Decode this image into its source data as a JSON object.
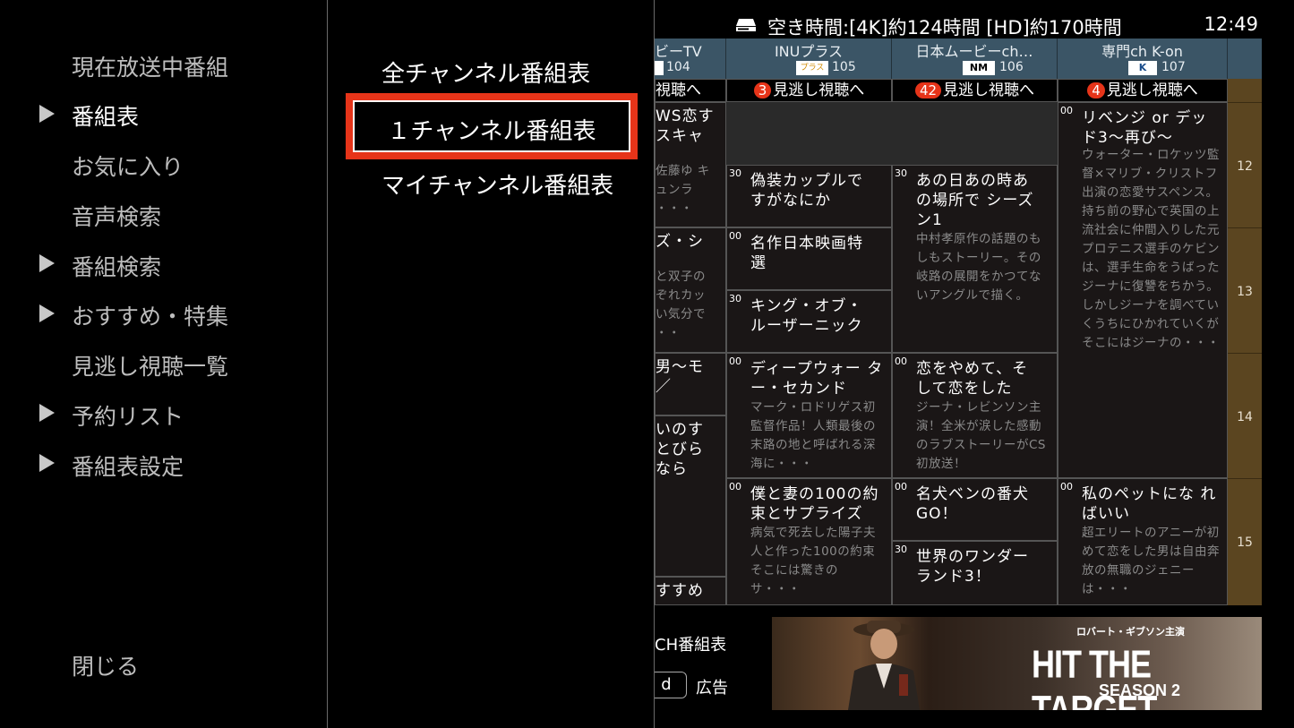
{
  "menu": {
    "items": [
      {
        "label": "現在放送中番組",
        "arrow": false,
        "active": false
      },
      {
        "label": "番組表",
        "arrow": true,
        "active": true
      },
      {
        "label": "お気に入り",
        "arrow": false,
        "active": false
      },
      {
        "label": "音声検索",
        "arrow": false,
        "active": false
      },
      {
        "label": "番組検索",
        "arrow": true,
        "active": false
      },
      {
        "label": "おすすめ・特集",
        "arrow": true,
        "active": false
      },
      {
        "label": "見逃し視聴一覧",
        "arrow": false,
        "active": false
      },
      {
        "label": "予約リスト",
        "arrow": true,
        "active": false
      },
      {
        "label": "番組表設定",
        "arrow": true,
        "active": false
      }
    ],
    "close_label": "閉じる"
  },
  "submenu": {
    "all_channels": "全チャンネル番組表",
    "one_channel": "１チャンネル番組表",
    "my_channel": "マイチャンネル番組表"
  },
  "guide": {
    "remaining_label": "空き時間:[4K]約124時間 [HD]約170時間",
    "clock": "12:49",
    "channels": [
      {
        "name": "ビーTV",
        "number": "104",
        "logo": "",
        "missed_count": "",
        "missed_label": "視聴へ"
      },
      {
        "name": "INUプラス",
        "number": "105",
        "logo": "プラス",
        "missed_count": "3",
        "missed_label": "見逃し視聴へ"
      },
      {
        "name": "日本ムービーch…",
        "number": "106",
        "logo": "NM",
        "missed_count": "42",
        "missed_label": "見逃し視聴へ"
      },
      {
        "name": "専門ch K-on",
        "number": "107",
        "logo": "K",
        "missed_count": "4",
        "missed_label": "見逃し視聴へ"
      }
    ],
    "hours": [
      "12",
      "13",
      "14",
      "15"
    ],
    "col0": [
      {
        "title": "WS恋す スキャ",
        "desc": "佐藤ゆ キュンラ ・・・"
      },
      {
        "title": "ズ・シ",
        "desc": "と双子の ぞれカッ い気分で ・・"
      },
      {
        "title": "男〜モ ／",
        "desc": ""
      },
      {
        "title": "いのす とびら なら",
        "desc": ""
      },
      {
        "title": "すすめ",
        "desc": ""
      }
    ],
    "col1": [
      {
        "time": "30",
        "title": "偽装カップルで すがなにか",
        "desc": ""
      },
      {
        "time": "00",
        "title": "名作日本映画特 選",
        "desc": ""
      },
      {
        "time": "30",
        "title": "キング・オブ・ ルーザーニック",
        "desc": ""
      },
      {
        "time": "00",
        "title": "ディープウォー ター・セカンド",
        "desc": "マーク・ロドリゲス初監督作品！人類最後の末路の地と呼ばれる深海に・・・"
      },
      {
        "time": "00",
        "title": "僕と妻の100の約 束とサプライズ",
        "desc": "病気で死去した陽子夫人と作った100の約束そこには驚きのサ・・・"
      }
    ],
    "col2": [
      {
        "time": "30",
        "title": "あの日あの時あ の場所で シーズ ン1",
        "desc": "中村孝原作の話題のもしもストーリー。その岐路の展開をかつてないアングルで描く。"
      },
      {
        "time": "00",
        "title": "恋をやめて、そ して恋をした",
        "desc": "ジーナ・レビンソン主演！全米が涙した感動のラブストーリーがCS初放送！"
      },
      {
        "time": "00",
        "title": "名犬ベンの番犬 GO！",
        "desc": ""
      },
      {
        "time": "30",
        "title": "世界のワンダー ランド3！",
        "desc": ""
      }
    ],
    "col3": [
      {
        "time": "00",
        "title": "リベンジ or デッ ド3〜再び〜",
        "desc": "ウォーター・ロケッツ監督×マリブ・クリストフ出演の恋愛サスペンス。持ち前の野心で英国の上流社会に仲間入りした元プロテニス選手のケビンは、選手生命をうばったジーナに復讐をちかう。しかしジーナを調べていくうちにひかれていくがそこにはジーナの・・・"
      },
      {
        "time": "00",
        "title": "私のペットにな ればいい",
        "desc": "超エリートのアニーが初めて恋をした男は自由奔放の無職のジェニーは・・・"
      }
    ],
    "bottom_label": "CH番組表",
    "d_button": "d",
    "ad_label": "広告",
    "ad": {
      "subtitle": "ロバート・ギブソン主演",
      "title": "HIT THE TARGET",
      "season": "SEASON 2"
    }
  }
}
